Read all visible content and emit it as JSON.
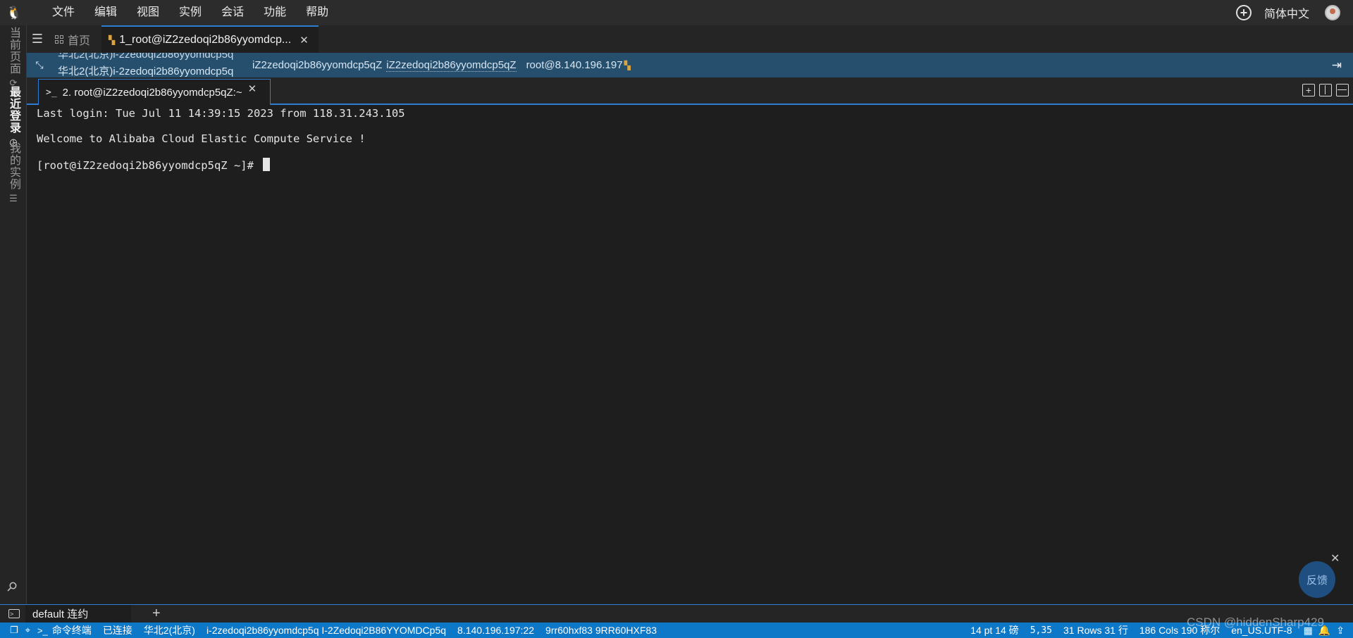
{
  "menubar": {
    "items": [
      "文件",
      "编辑",
      "视图",
      "实例",
      "会话",
      "功能",
      "帮助"
    ],
    "language": "简体中文"
  },
  "activitybar": {
    "items": [
      {
        "label": "当前页面",
        "icon": "refresh-icon"
      },
      {
        "label": "最近登录",
        "icon": "history-icon"
      },
      {
        "label": "我的实例",
        "icon": "list-icon"
      }
    ]
  },
  "tabs": {
    "home": "首页",
    "session": "1_root@iZ2zedoqi2b86yyomdcp..."
  },
  "infobar": {
    "region_top": "华北2(北京)i-2zedoqi2b86yyomdcp5q",
    "region_main": "华北2(北京)i-2zedoqi2b86yyomdcp5q",
    "hostname": "iZ2zedoqi2b86yyomdcp5qZ",
    "hostname_link": "iZ2zedoqi2b86yyomdcp5qZ",
    "host": "root@8.140.196.197"
  },
  "terminal_tab": {
    "prompt": ">_",
    "label": "2. root@iZ2zedoqi2b86yyomdcp5qZ:~"
  },
  "terminal": {
    "lines": [
      "Last login: Tue Jul 11 14:39:15 2023 from 118.31.243.105",
      "Welcome to Alibaba Cloud Elastic Compute Service !",
      "[root@iZ2zedoqi2b86yyomdcp5qZ ~]# "
    ]
  },
  "feedback": {
    "label": "反馈"
  },
  "session_bar": {
    "tab_label": "default 连约"
  },
  "statusbar": {
    "terminal_label": "命令终端",
    "connection": "已连接",
    "region": "华北2(北京)",
    "instance": "i-2zedoqi2b86yyomdcp5q I-2Zedoqi2B86YYOMDCp5q",
    "address": "8.140.196.197:22",
    "code": "9rr60hxf83 9RR60HXF83",
    "font": "14 pt 14 磅",
    "cursor_pos": "5,35",
    "rows": "31 Rows 31 行",
    "cols": "186 Cols 190 称尔",
    "encoding": "en_US.UTF-8"
  },
  "watermark": "CSDN @hiddenSharp429",
  "colors": {
    "accent": "#2d7dd2",
    "statusbar": "#0e78c8",
    "infobar": "#264f6e",
    "terminal_bg": "#1e1e1e"
  }
}
